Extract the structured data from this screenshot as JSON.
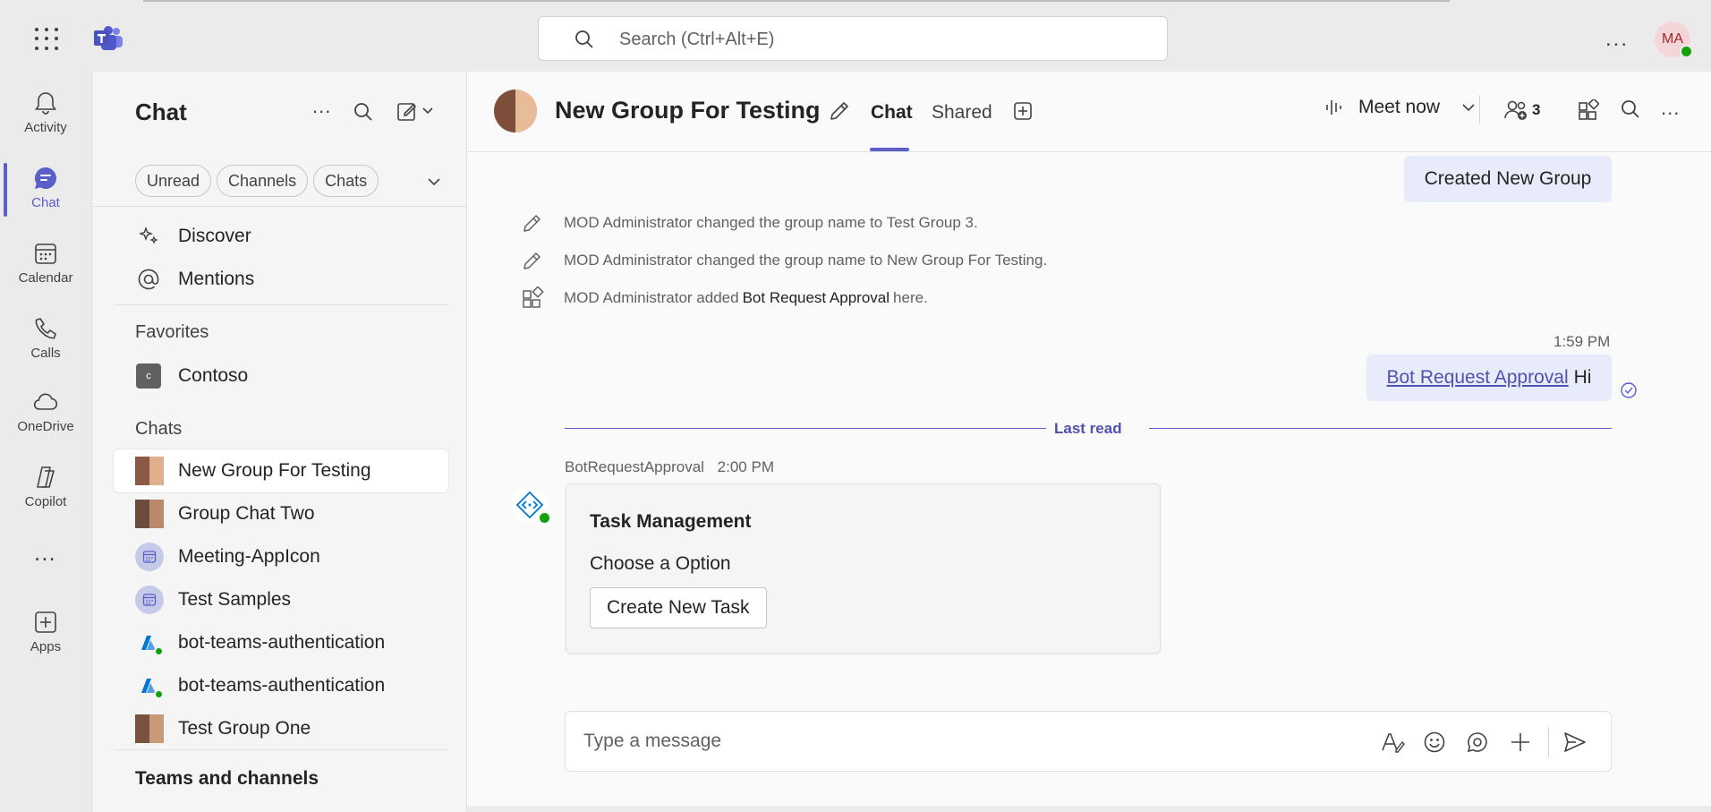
{
  "topbar": {
    "search_placeholder": "Search (Ctrl+Alt+E)",
    "more_label": "...",
    "user_initials": "MA"
  },
  "rail": {
    "items": [
      {
        "label": "Activity",
        "icon": "bell-icon"
      },
      {
        "label": "Chat",
        "icon": "chat-icon"
      },
      {
        "label": "Calendar",
        "icon": "calendar-icon"
      },
      {
        "label": "Calls",
        "icon": "phone-icon"
      },
      {
        "label": "OneDrive",
        "icon": "cloud-icon"
      },
      {
        "label": "Copilot",
        "icon": "copilot-icon"
      },
      {
        "label": "Apps",
        "icon": "add-app-icon"
      }
    ],
    "more_label": "..."
  },
  "pane": {
    "title": "Chat",
    "more_label": "...",
    "filters": [
      "Unread",
      "Channels",
      "Chats"
    ],
    "nav": [
      {
        "label": "Discover",
        "icon": "sparkle-icon"
      },
      {
        "label": "Mentions",
        "icon": "at-icon"
      }
    ],
    "favorites_heading": "Favorites",
    "favorites": [
      {
        "label": "Contoso",
        "tile": "c"
      }
    ],
    "chats_heading": "Chats",
    "chats": [
      {
        "label": "New Group For Testing",
        "avatar": "photo"
      },
      {
        "label": "Group Chat Two",
        "avatar": "photo"
      },
      {
        "label": "Meeting-AppIcon",
        "avatar": "calendar"
      },
      {
        "label": "Test Samples",
        "avatar": "calendar"
      },
      {
        "label": "bot-teams-authentication",
        "avatar": "bot"
      },
      {
        "label": "bot-teams-authentication",
        "avatar": "bot"
      },
      {
        "label": "Test Group One",
        "avatar": "photo"
      }
    ],
    "teams_heading": "Teams and channels"
  },
  "conversation": {
    "title": "New Group For Testing",
    "tabs": [
      "Chat",
      "Shared"
    ],
    "meet_label": "Meet now",
    "participants_count": "3",
    "more_label": "...",
    "created_message": "Created New Group",
    "system_events": [
      {
        "icon": "pencil-icon",
        "before": "MOD Administrator changed the group name to Test Group 3.",
        "bold": "",
        "after": ""
      },
      {
        "icon": "pencil-icon",
        "before": "MOD Administrator changed the group name to New Group For Testing.",
        "bold": "",
        "after": ""
      },
      {
        "icon": "apps-icon",
        "before": "MOD Administrator added",
        "bold": "Bot Request Approval",
        "after": "here."
      }
    ],
    "sent_time": "1:59 PM",
    "sent_mention": "Bot Request Approval",
    "sent_text": "Hi",
    "last_read_label": "Last read",
    "bot_name": "BotRequestApproval",
    "bot_time": "2:00 PM",
    "card": {
      "title": "Task Management",
      "text": "Choose a Option",
      "button": "Create New Task"
    },
    "composer_placeholder": "Type a message"
  },
  "colors": {
    "accent": "#5b5fc7",
    "bubble": "#e8ebfa",
    "presence": "#13a10e"
  }
}
